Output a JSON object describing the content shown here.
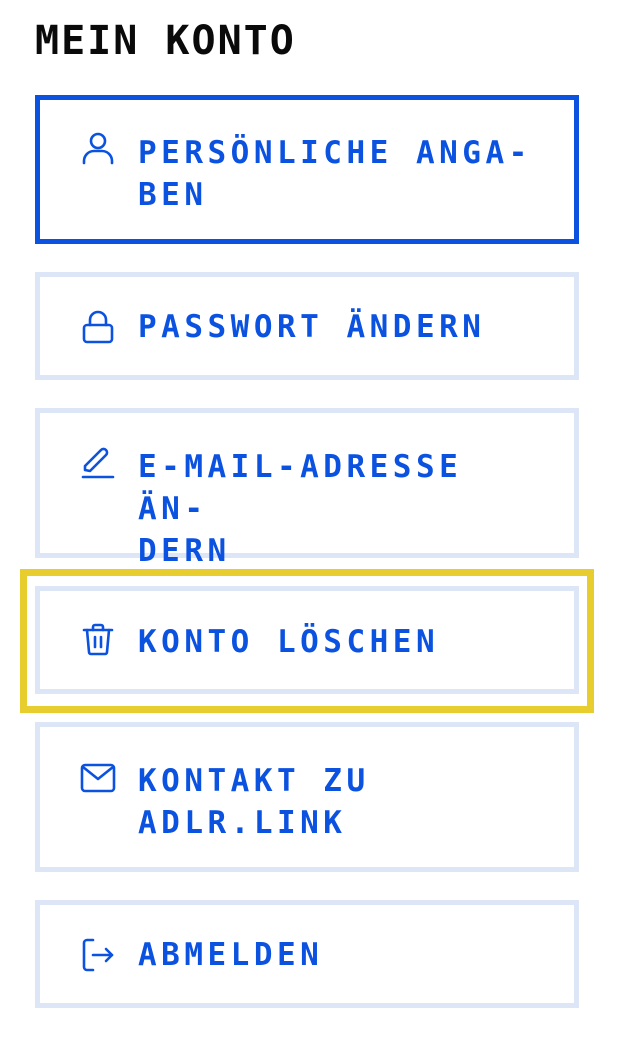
{
  "header": {
    "title": "MEIN KONTO"
  },
  "menu": {
    "items": [
      {
        "label": "PERSÖNLICHE ANGA-BEN",
        "line1": "PERSÖNLICHE ANGA-",
        "line2": "BEN",
        "icon": "user-icon",
        "active": true
      },
      {
        "label": "PASSWORT ÄNDERN",
        "line1": "PASSWORT ÄNDERN",
        "icon": "lock-icon",
        "active": false
      },
      {
        "label": "E-MAIL-ADRESSE ÄN-DERN",
        "line1": "E-MAIL-ADRESSE ÄN-",
        "line2": "DERN",
        "icon": "pencil-icon",
        "active": false
      },
      {
        "label": "KONTO LÖSCHEN",
        "line1": "KONTO LÖSCHEN",
        "icon": "trash-icon",
        "active": false,
        "focused": true
      },
      {
        "label": "KONTAKT ZU ADLR.LINK",
        "line1": "KONTAKT ZU",
        "line2": "ADLR.LINK",
        "icon": "mail-icon",
        "active": false
      },
      {
        "label": "ABMELDEN",
        "line1": "ABMELDEN",
        "icon": "logout-icon",
        "active": false
      }
    ]
  },
  "colors": {
    "accent": "#0b52e0",
    "border": "#dde6f7",
    "focus": "#e8cd2e",
    "title": "#0a0a0a"
  }
}
